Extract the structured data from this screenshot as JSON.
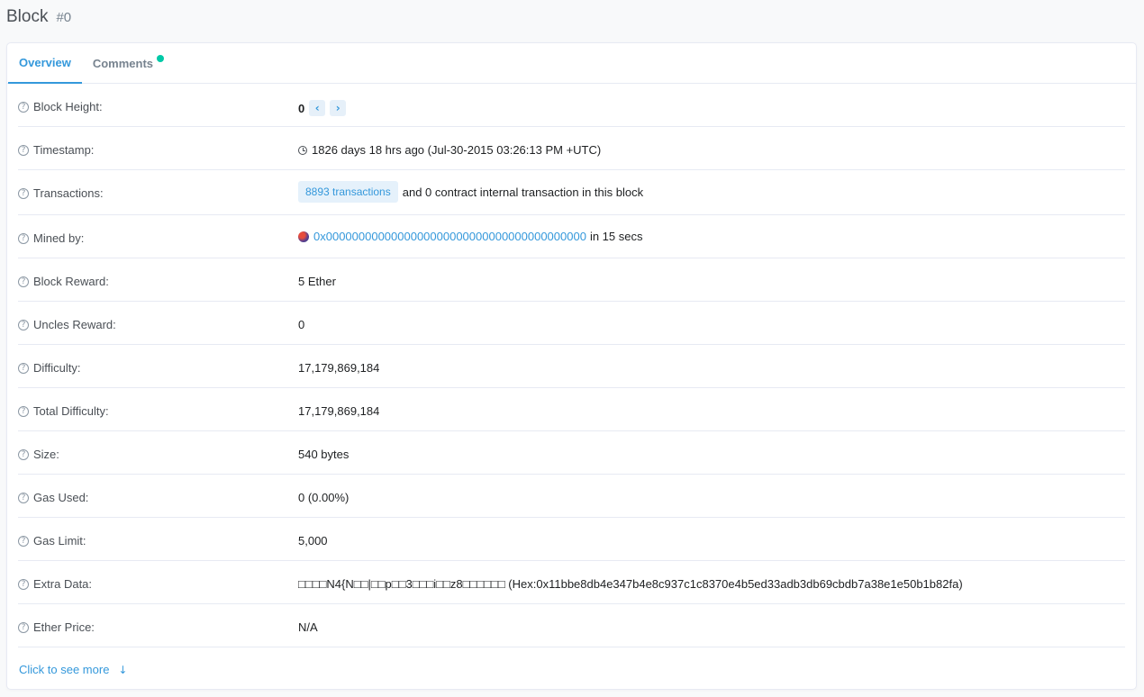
{
  "header": {
    "title": "Block",
    "subtitle": "#0"
  },
  "tabs": [
    {
      "label": "Overview"
    },
    {
      "label": "Comments"
    }
  ],
  "rows": {
    "block_height": {
      "label": "Block Height:",
      "value": "0",
      "prev": "‹",
      "next": "›"
    },
    "timestamp": {
      "label": "Timestamp:",
      "value": "1826 days 18 hrs ago (Jul-30-2015 03:26:13 PM +UTC)"
    },
    "transactions": {
      "label": "Transactions:",
      "badge": "8893 transactions",
      "suffix": "and 0 contract internal transaction in this block"
    },
    "mined_by": {
      "label": "Mined by:",
      "address": "0x0000000000000000000000000000000000000000",
      "suffix": "in 15 secs"
    },
    "block_reward": {
      "label": "Block Reward:",
      "value": "5 Ether"
    },
    "uncles_reward": {
      "label": "Uncles Reward:",
      "value": "0"
    },
    "difficulty": {
      "label": "Difficulty:",
      "value": "17,179,869,184"
    },
    "total_difficulty": {
      "label": "Total Difficulty:",
      "value": "17,179,869,184"
    },
    "size": {
      "label": "Size:",
      "value": "540 bytes"
    },
    "gas_used": {
      "label": "Gas Used:",
      "value": "0 (0.00%)"
    },
    "gas_limit": {
      "label": "Gas Limit:",
      "value": "5,000"
    },
    "extra_data": {
      "label": "Extra Data:",
      "value": "□□□□N4{N□□|□□p□□3□□□i□□z8□□□□□□ (Hex:0x11bbe8db4e347b4e8c937c1c8370e4b5ed33adb3db69cbdb7a38e1e50b1b82fa)"
    },
    "ether_price": {
      "label": "Ether Price:",
      "value": "N/A"
    }
  },
  "help_icon_glyph": "?",
  "see_more": {
    "label": "Click to see more",
    "arrow": "↓"
  },
  "colors": {
    "accent": "#3498db",
    "dot": "#00c9a7",
    "border": "#e7eaf3"
  }
}
